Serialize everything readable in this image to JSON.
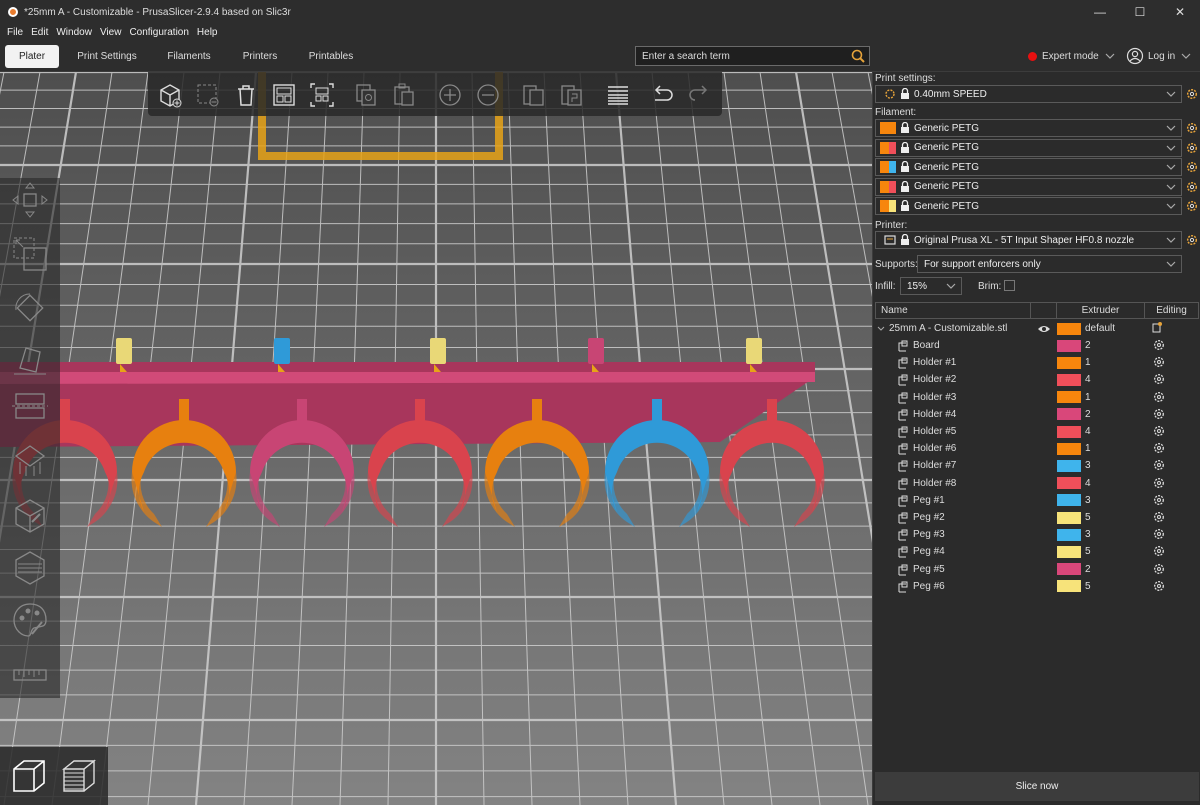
{
  "window": {
    "title": "*25mm A - Customizable - PrusaSlicer-2.9.4 based on Slic3r",
    "minimize": "—",
    "maximize": "☐",
    "close": "✕"
  },
  "menu": [
    "File",
    "Edit",
    "Window",
    "View",
    "Configuration",
    "Help"
  ],
  "tabs": [
    "Plater",
    "Print Settings",
    "Filaments",
    "Printers",
    "Printables"
  ],
  "search": {
    "placeholder": "Enter a search term"
  },
  "mode": "Expert mode",
  "login": "Log in",
  "panel": {
    "print_settings_label": "Print settings:",
    "print_profile": "0.40mm SPEED",
    "filament_label": "Filament:",
    "filaments": [
      {
        "name": "Generic PETG",
        "color": "#f7860d"
      },
      {
        "name": "Generic PETG",
        "color": "#f04f5a"
      },
      {
        "name": "Generic PETG",
        "color": "#3fb4ec"
      },
      {
        "name": "Generic PETG",
        "color": "#f04f5a"
      },
      {
        "name": "Generic PETG",
        "color": "#f7e37a"
      }
    ],
    "printer_label": "Printer:",
    "printer": "Original Prusa XL - 5T Input Shaper HF0.8 nozzle",
    "supports_label": "Supports:",
    "supports_value": "For support enforcers only",
    "infill_label": "Infill:",
    "infill_value": "15%",
    "brim_label": "Brim:",
    "columns": {
      "name": "Name",
      "extruder": "Extruder",
      "editing": "Editing"
    },
    "root": {
      "name": "25mm A - Customizable.stl",
      "extruder": "default",
      "color": "#f7860d"
    },
    "parts": [
      {
        "name": "Board",
        "extruder": "2",
        "color": "#d9477a"
      },
      {
        "name": "Holder #1",
        "extruder": "1",
        "color": "#f7860d"
      },
      {
        "name": "Holder #2",
        "extruder": "4",
        "color": "#f04f5a"
      },
      {
        "name": "Holder #3",
        "extruder": "1",
        "color": "#f7860d"
      },
      {
        "name": "Holder #4",
        "extruder": "2",
        "color": "#d9477a"
      },
      {
        "name": "Holder #5",
        "extruder": "4",
        "color": "#f04f5a"
      },
      {
        "name": "Holder #6",
        "extruder": "1",
        "color": "#f7860d"
      },
      {
        "name": "Holder #7",
        "extruder": "3",
        "color": "#3fb4ec"
      },
      {
        "name": "Holder #8",
        "extruder": "4",
        "color": "#f04f5a"
      },
      {
        "name": "Peg #1",
        "extruder": "3",
        "color": "#3fb4ec"
      },
      {
        "name": "Peg #2",
        "extruder": "5",
        "color": "#f7e37a"
      },
      {
        "name": "Peg #3",
        "extruder": "3",
        "color": "#3fb4ec"
      },
      {
        "name": "Peg #4",
        "extruder": "5",
        "color": "#f7e37a"
      },
      {
        "name": "Peg #5",
        "extruder": "2",
        "color": "#d9477a"
      },
      {
        "name": "Peg #6",
        "extruder": "5",
        "color": "#f7e37a"
      }
    ],
    "slice": "Slice now"
  },
  "icons": {
    "gear": "gear-icon",
    "lock": "lock-icon",
    "eye": "eye-icon",
    "search": "search-icon"
  },
  "colors": {
    "board": "#c0406a",
    "holder_red": "#d9434d",
    "holder_orange": "#e7800f",
    "holder_pink": "#c84574",
    "holder_blue": "#2f9ad8",
    "peg_yellow": "#e9d877",
    "selection": "#e8a317"
  }
}
